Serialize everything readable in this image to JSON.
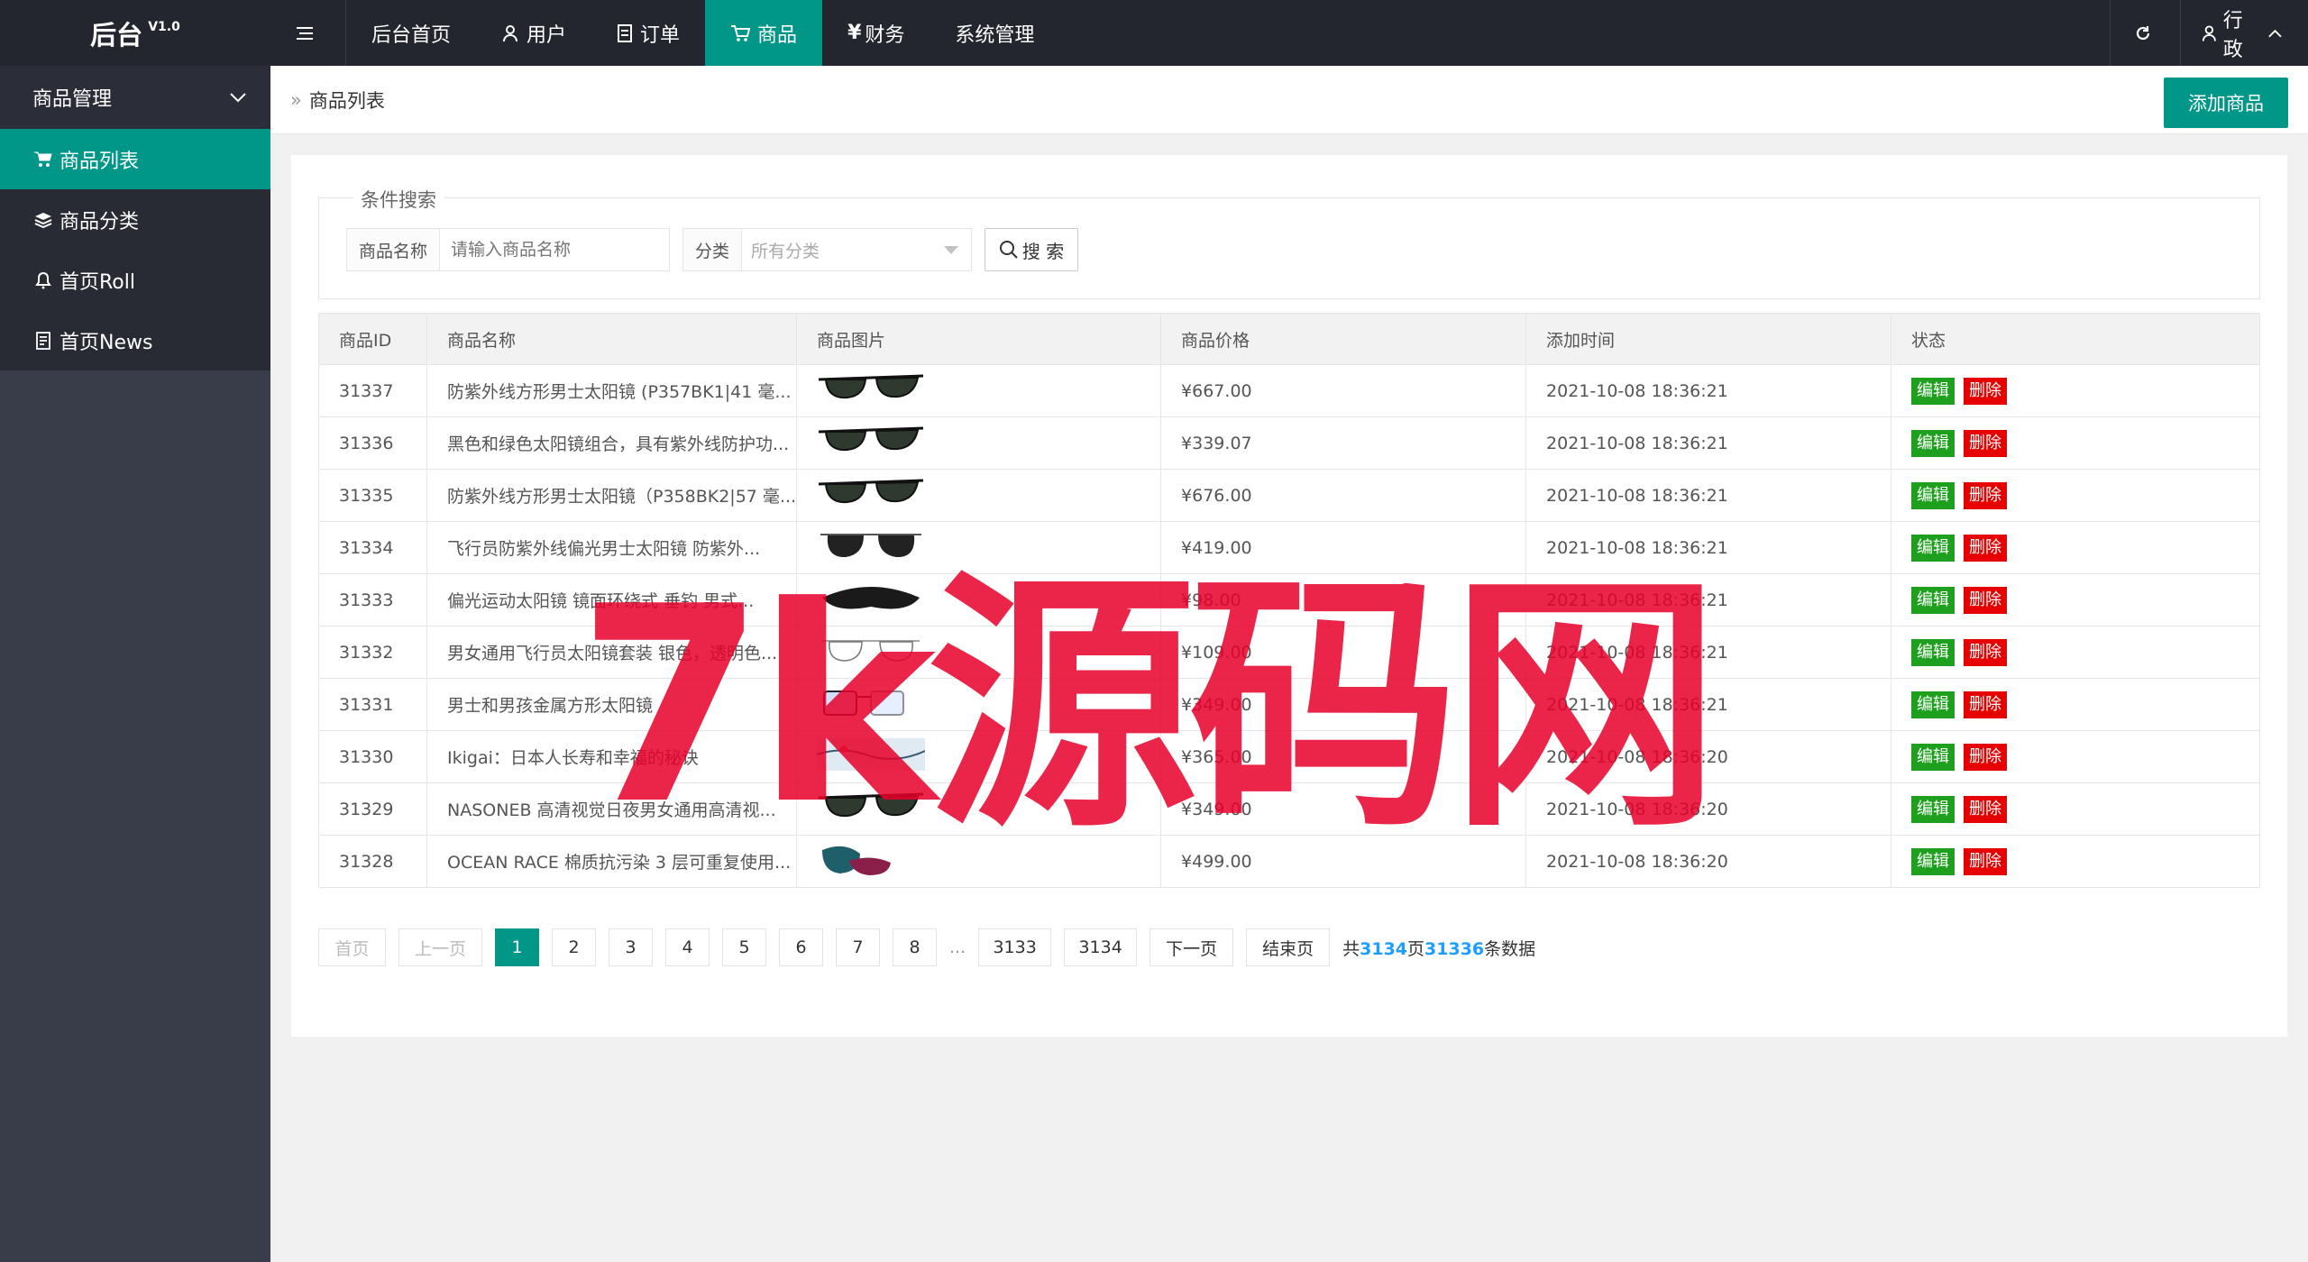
{
  "app": {
    "name": "后台",
    "version": "V1.0"
  },
  "nav": [
    {
      "label": "后台首页",
      "icon": ""
    },
    {
      "label": "用户",
      "icon": "user-icon"
    },
    {
      "label": "订单",
      "icon": "document-icon"
    },
    {
      "label": "商品",
      "icon": "cart-icon",
      "active": true
    },
    {
      "label": "财务",
      "icon": "yen-icon"
    },
    {
      "label": "系统管理",
      "icon": ""
    }
  ],
  "topright": {
    "user": "行政"
  },
  "sidebar": {
    "group": "商品管理",
    "items": [
      {
        "label": "商品列表",
        "icon": "cart-icon",
        "active": true
      },
      {
        "label": "商品分类",
        "icon": "layers-icon"
      },
      {
        "label": "首页Roll",
        "icon": "bell-icon"
      },
      {
        "label": "首页News",
        "icon": "list-icon"
      }
    ]
  },
  "breadcrumb": "商品列表",
  "add_button": "添加商品",
  "search": {
    "legend": "条件搜索",
    "name_label": "商品名称",
    "name_placeholder": "请输入商品名称",
    "cat_label": "分类",
    "cat_value": "所有分类",
    "button": "搜 索"
  },
  "table": {
    "headers": [
      "商品ID",
      "商品名称",
      "商品图片",
      "商品价格",
      "添加时间",
      "状态"
    ],
    "rows": [
      {
        "id": "31337",
        "name": "防紫外线方形男士太阳镜 (P357BK1|41 毫...",
        "price": "¥667.00",
        "time": "2021-10-08 18:36:21",
        "img": "sunglasses"
      },
      {
        "id": "31336",
        "name": "黑色和绿色太阳镜组合，具有紫外线防护功...",
        "price": "¥339.07",
        "time": "2021-10-08 18:36:21",
        "img": "sunglasses"
      },
      {
        "id": "31335",
        "name": "防紫外线方形男士太阳镜（P358BK2|57 毫...",
        "price": "¥676.00",
        "time": "2021-10-08 18:36:21",
        "img": "sunglasses"
      },
      {
        "id": "31334",
        "name": "飞行员防紫外线偏光男士太阳镜 防紫外...",
        "price": "¥419.00",
        "time": "2021-10-08 18:36:21",
        "img": "aviator"
      },
      {
        "id": "31333",
        "name": "偏光运动太阳镜 镜面环绕式 垂钓 男式...",
        "price": "¥98.00",
        "time": "2021-10-08 18:36:21",
        "img": "sport"
      },
      {
        "id": "31332",
        "name": "男女通用飞行员太阳镜套装 银色，透明色...",
        "price": "¥109.00",
        "time": "2021-10-08 18:36:21",
        "img": "wire"
      },
      {
        "id": "31331",
        "name": "男士和男孩金属方形太阳镜",
        "price": "¥349.00",
        "time": "2021-10-08 18:36:21",
        "img": "blue"
      },
      {
        "id": "31330",
        "name": "Ikigai：日本人长寿和幸福的秘诀",
        "price": "¥365.00",
        "time": "2021-10-08 18:36:20",
        "img": "book"
      },
      {
        "id": "31329",
        "name": "NASONEB 高清视觉日夜男女通用高清视...",
        "price": "¥349.00",
        "time": "2021-10-08 18:36:20",
        "img": "sunglasses"
      },
      {
        "id": "31328",
        "name": "OCEAN RACE 棉质抗污染 3 层可重复使用...",
        "price": "¥499.00",
        "time": "2021-10-08 18:36:20",
        "img": "mask"
      }
    ],
    "edit_label": "编辑",
    "delete_label": "删除"
  },
  "pager": {
    "first": "首页",
    "prev": "上一页",
    "next": "下一页",
    "last": "结束页",
    "pages": [
      "1",
      "2",
      "3",
      "4",
      "5",
      "6",
      "7",
      "8"
    ],
    "dots": "...",
    "tail_pages": [
      "3133",
      "3134"
    ],
    "info_prefix": "共",
    "total_pages": "3134",
    "info_mid": "页",
    "total_items": "31336",
    "info_suffix": "条数据"
  },
  "watermark": "7k源码网",
  "colors": {
    "accent": "#009688",
    "topbar": "#23262e",
    "sidebar": "#393d49",
    "edit": "#1e9f1e",
    "delete": "#e60000",
    "link": "#1e9fff"
  }
}
